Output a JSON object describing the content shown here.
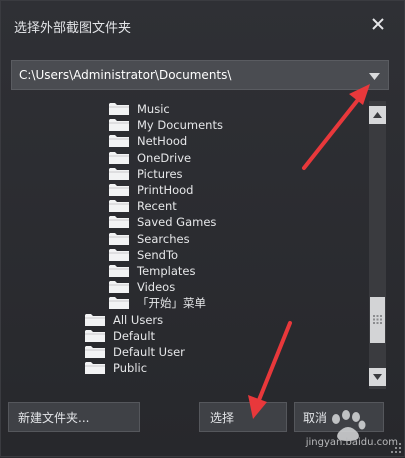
{
  "dialog": {
    "title": "选择外部截图文件夹",
    "path": "C:\\Users\\Administrator\\Documents\\"
  },
  "folders": [
    {
      "label": "Music",
      "level": 2
    },
    {
      "label": "My Documents",
      "level": 2
    },
    {
      "label": "NetHood",
      "level": 2
    },
    {
      "label": "OneDrive",
      "level": 2
    },
    {
      "label": "Pictures",
      "level": 2
    },
    {
      "label": "PrintHood",
      "level": 2
    },
    {
      "label": "Recent",
      "level": 2
    },
    {
      "label": "Saved Games",
      "level": 2
    },
    {
      "label": "Searches",
      "level": 2
    },
    {
      "label": "SendTo",
      "level": 2
    },
    {
      "label": "Templates",
      "level": 2
    },
    {
      "label": "Videos",
      "level": 2
    },
    {
      "label": "「开始」菜单",
      "level": 2
    },
    {
      "label": "All Users",
      "level": 1
    },
    {
      "label": "Default",
      "level": 1
    },
    {
      "label": "Default User",
      "level": 1
    },
    {
      "label": "Public",
      "level": 1
    }
  ],
  "buttons": {
    "new_folder": "新建文件夹...",
    "select": "选择",
    "cancel": "取消"
  },
  "watermark": {
    "url": "jingyan.baidu.com"
  },
  "colors": {
    "annotation_arrow": "#e8383b",
    "background": "#2b2c30",
    "path_box": "#4a4c51"
  }
}
